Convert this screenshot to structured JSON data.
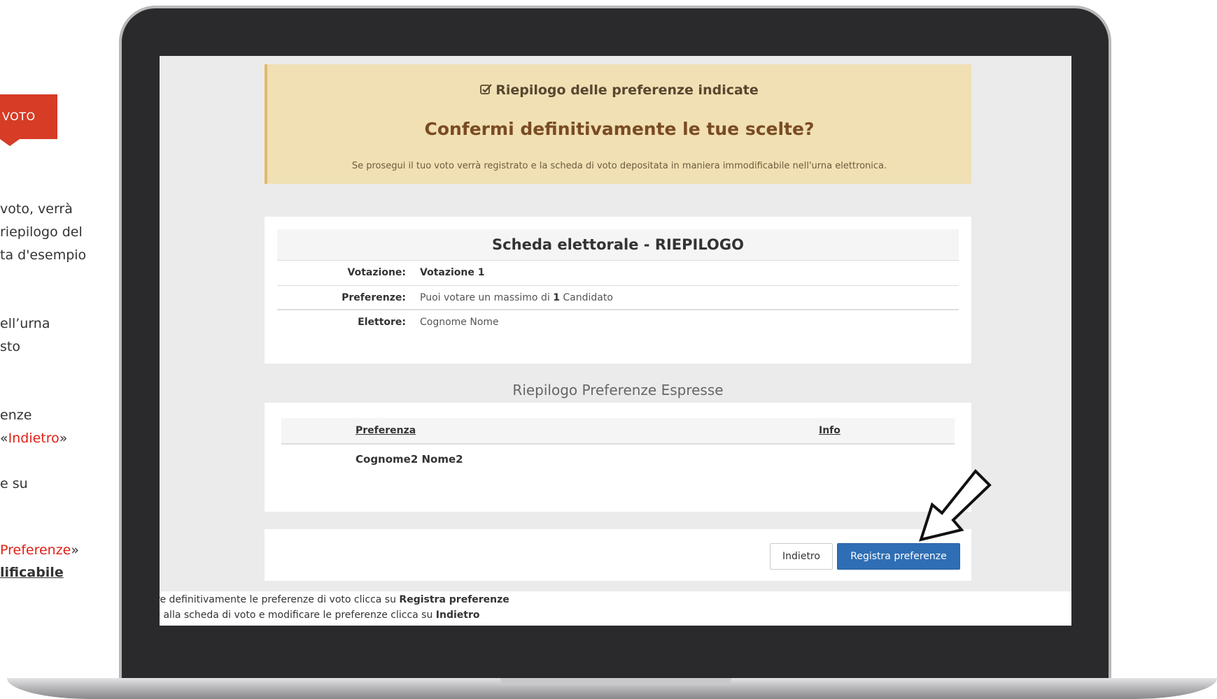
{
  "slide": {
    "vote_tag": "VOTO",
    "lines": [
      {
        "pre": "voto, verrà",
        "red": "",
        "post": "",
        "bold": ""
      },
      {
        "pre": "riepilogo del",
        "red": "",
        "post": "",
        "bold": ""
      },
      {
        "pre": "ta d'esempio",
        "red": "",
        "post": "",
        "bold": ""
      },
      {
        "pre": "ell’urna",
        "red": "",
        "post": "",
        "bold": ""
      },
      {
        "pre": "sto",
        "red": "",
        "post": "",
        "bold": ""
      },
      {
        "pre": "enze",
        "red": "",
        "post": "",
        "bold": ""
      },
      {
        "pre": "«",
        "red": "Indietro",
        "post": "»",
        "bold": ""
      },
      {
        "pre": "e su",
        "red": "",
        "post": "",
        "bold": ""
      },
      {
        "pre": "",
        "red": "Preferenze",
        "post": "»",
        "bold": ""
      },
      {
        "pre": "",
        "red": "",
        "post": "",
        "bold": "lificabile"
      }
    ]
  },
  "confirm": {
    "heading": "Riepilogo delle preferenze indicate",
    "question": "Confermi definitivamente le tue scelte?",
    "note": "Se prosegui il tuo voto verrà registrato e la scheda di voto depositata in maniera immodificabile nell'urna elettronica."
  },
  "scheda": {
    "title": "Scheda elettorale - RIEPILOGO",
    "votazione_label": "Votazione:",
    "votazione_value": "Votazione 1",
    "preferenze_label": "Preferenze:",
    "preferenze_pre": "Puoi votare un massimo di",
    "preferenze_num": "1",
    "preferenze_post": "Candidato",
    "elettore_label": "Elettore:",
    "elettore_value": "Cognome Nome"
  },
  "espresse": {
    "title": "Riepilogo Preferenze Espresse",
    "col_preferenza": "Preferenza",
    "col_info": "Info",
    "rows": [
      {
        "name": "Cognome2 Nome2",
        "info": ""
      }
    ]
  },
  "actions": {
    "back": "Indietro",
    "register": "Registra preferenze"
  },
  "help": {
    "line1_pre": "istrare definitivamente le preferenze di voto clicca su",
    "line1_bold": "Registra preferenze",
    "line2_pre": "rnare alla scheda di voto e modificare le preferenze clicca su",
    "line2_bold": "Indietro"
  },
  "colors": {
    "vote_tag": "#d63c26",
    "confirm_bg": "#f0e0b4",
    "primary_button": "#2f6eb4",
    "highlight_text": "#e02015"
  },
  "icons": {
    "heading_icon": "check-square-icon",
    "pointer": "arrow-cursor-icon"
  }
}
